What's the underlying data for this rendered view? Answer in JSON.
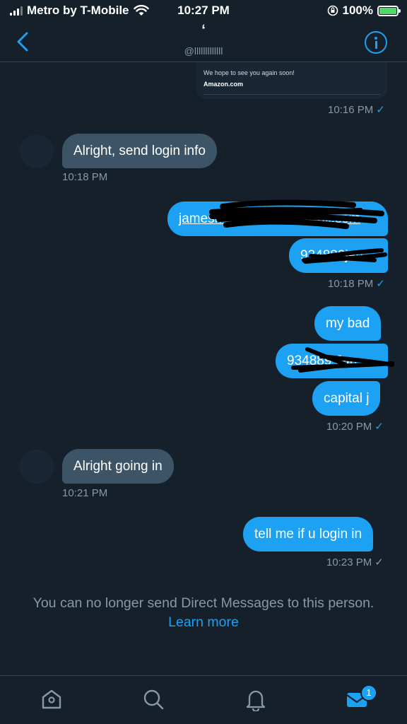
{
  "status_bar": {
    "carrier": "Metro by T-Mobile",
    "time": "10:27 PM",
    "battery": "100%"
  },
  "header": {
    "name": "ʻ",
    "handle": "@lllllllllllll",
    "back_icon": "chevron-left-icon",
    "info_icon": "info-icon"
  },
  "shared_card": {
    "line1": "We hope to see you again soon!",
    "line2": "Amazon.com"
  },
  "messages": [
    {
      "dir": "sent",
      "time": "10:16 PM",
      "status": "read"
    },
    {
      "dir": "received",
      "text": "Alright, send login info",
      "time": "10:18 PM"
    },
    {
      "dir": "sent",
      "text": "jamesn••••••••••6996••••ail.com",
      "redacted": true
    },
    {
      "dir": "sent",
      "text": "934889jan",
      "redacted": true,
      "time": "10:18 PM",
      "status": "read"
    },
    {
      "dir": "sent",
      "text": "my bad"
    },
    {
      "dir": "sent",
      "text": "934889 Jan",
      "redacted": true
    },
    {
      "dir": "sent",
      "text": "capital j",
      "time": "10:20 PM",
      "status": "read"
    },
    {
      "dir": "received",
      "text": "Alright going in",
      "time": "10:21 PM"
    },
    {
      "dir": "sent",
      "text": "tell me if u login in",
      "time": "10:23 PM",
      "status": "sent"
    }
  ],
  "notice": {
    "text": "You can no longer send Direct Messages to this person.",
    "link": "Learn more"
  },
  "tabbar": {
    "items": [
      "home-icon",
      "search-icon",
      "notifications-icon",
      "messages-icon"
    ],
    "messages_badge": "1"
  },
  "colors": {
    "background": "#15202b",
    "accent": "#1da1f2",
    "received_bubble": "#3d5466",
    "muted": "#8899a6"
  }
}
